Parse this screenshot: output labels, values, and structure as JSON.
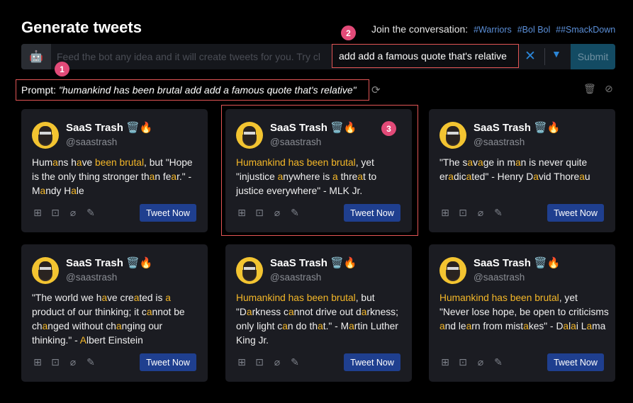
{
  "header": {
    "title": "Generate tweets",
    "join_label": "Join the conversation:",
    "tags": [
      "#Warriors",
      "#Bol Bol",
      "##SmackDown"
    ]
  },
  "search": {
    "bot_icon": "robot-icon",
    "placeholder": "Feed the bot any idea and it will create tweets for you. Try cl",
    "value": "add add a famous quote that's relative",
    "clear": "✕",
    "chevron": "⌄",
    "submit_label": "Submit"
  },
  "prompt": {
    "label": "Prompt:",
    "value": "\"humankind has been brutal add add a famous quote that's relative\""
  },
  "badges": [
    "1",
    "2",
    "3"
  ],
  "tweet_button_label": "Tweet Now",
  "author": {
    "name": "SaaS Trash 🗑️🔥",
    "handle": "@saastrash"
  },
  "cards": [
    {
      "html": "Hum<span class=\"hl\">a</span>ns h<span class=\"hl\">a</span>ve <span class=\"hl\">been brutal</span>, but \"Hope is the only thing stronger th<span class=\"hl\">a</span>n fe<span class=\"hl\">a</span>r.\" -M<span class=\"hl\">a</span>ndy H<span class=\"hl\">a</span>le"
    },
    {
      "html": "<span class=\"hl\">Humankind has been brutal</span>, yet \"injustice <span class=\"hl\">a</span>nywhere is <span class=\"hl\">a</span> thre<span class=\"hl\">a</span>t to justice everywhere\" - MLK Jr."
    },
    {
      "html": "\"The s<span class=\"hl\">a</span>v<span class=\"hl\">a</span>ge in m<span class=\"hl\">a</span>n is never quite er<span class=\"hl\">a</span>dic<span class=\"hl\">a</span>ted\" - Henry D<span class=\"hl\">a</span>vid Thore<span class=\"hl\">a</span>u"
    },
    {
      "html": "\"The world we h<span class=\"hl\">a</span>ve cre<span class=\"hl\">a</span>ted is <span class=\"hl\">a</span> product of our thinking; it c<span class=\"hl\">a</span>nnot be ch<span class=\"hl\">a</span>nged without ch<span class=\"hl\">a</span>nging our thinking.\" - <span class=\"hl\">A</span>lbert Einstein"
    },
    {
      "html": "<span class=\"hl\">Humankind has been brutal</span>, but \"D<span class=\"hl\">a</span>rkness c<span class=\"hl\">a</span>nnot drive out d<span class=\"hl\">a</span>rkness; only light c<span class=\"hl\">a</span>n do th<span class=\"hl\">a</span>t.\" - M<span class=\"hl\">a</span>rtin Luther King Jr."
    },
    {
      "html": "<span class=\"hl\">Humankind has been brutal</span>, yet \"Never lose hope, be open to criticisms <span class=\"hl\">a</span>nd le<span class=\"hl\">a</span>rn from mist<span class=\"hl\">a</span>kes\" - D<span class=\"hl\">a</span>l<span class=\"hl\">a</span>i L<span class=\"hl\">a</span>ma"
    }
  ],
  "card_icons": [
    "add-media-icon",
    "add-image-icon",
    "attach-icon",
    "edit-icon"
  ]
}
